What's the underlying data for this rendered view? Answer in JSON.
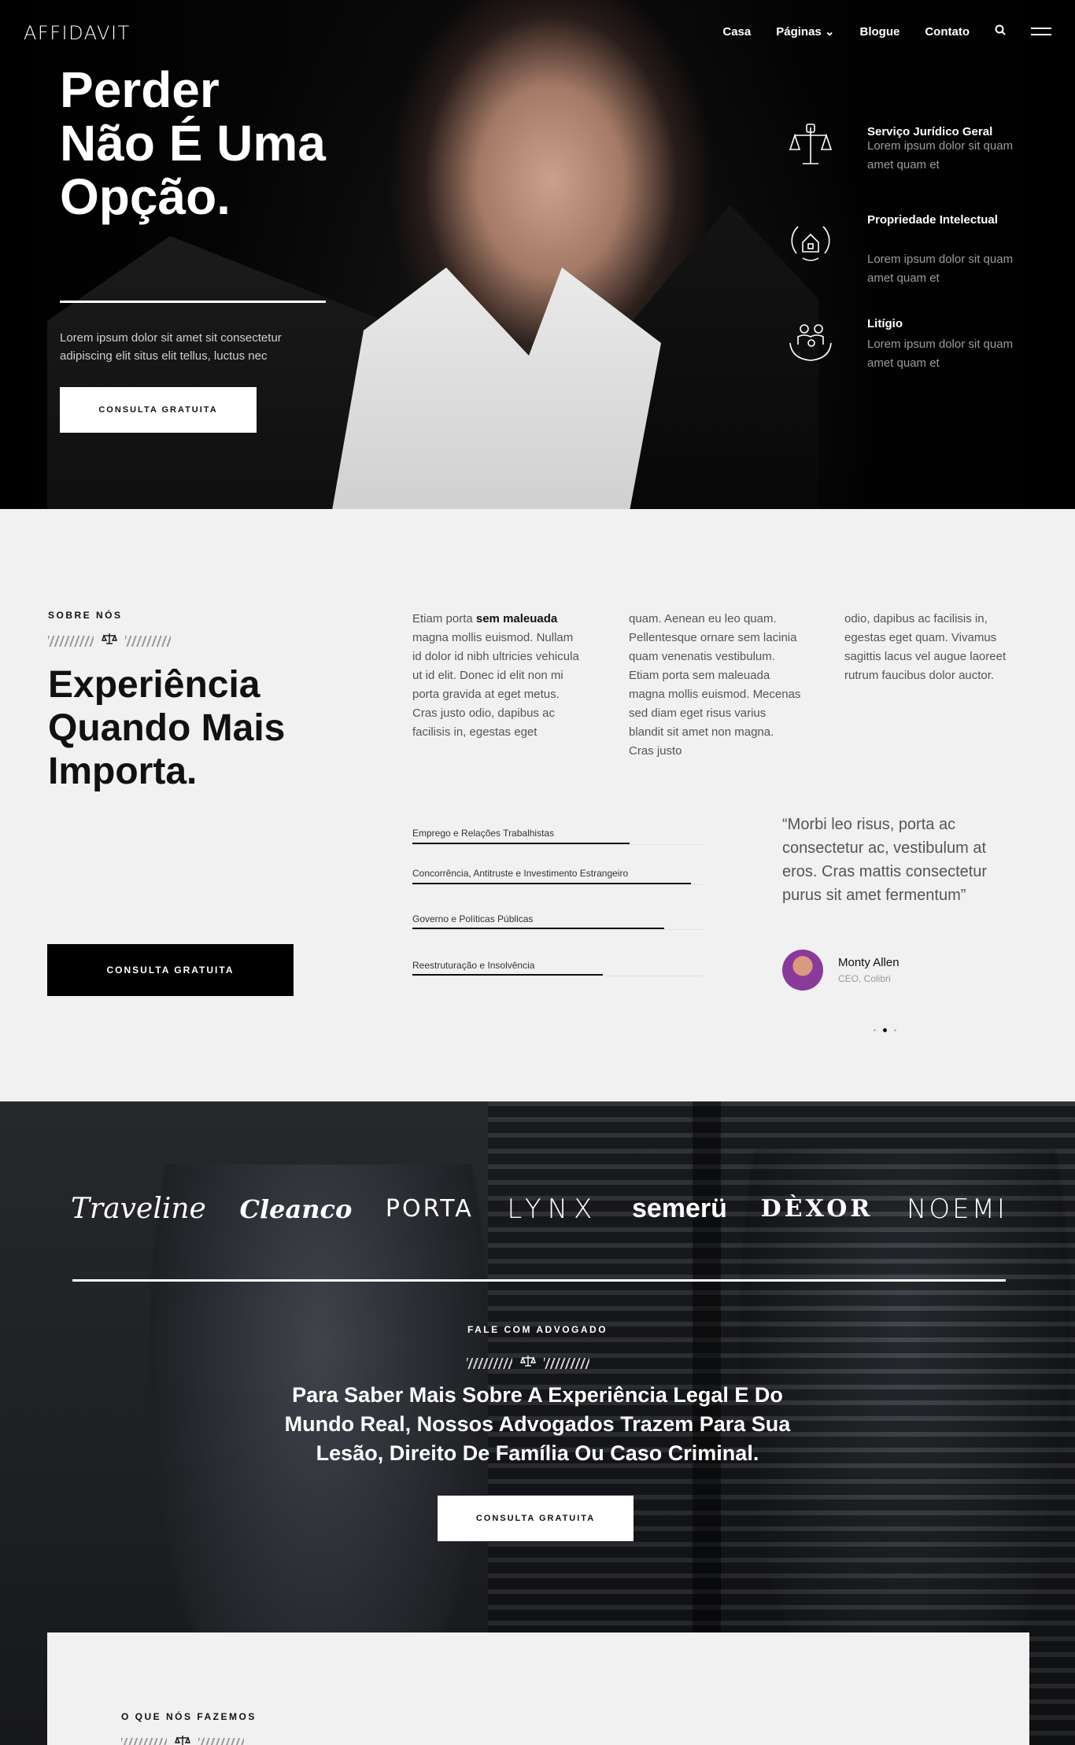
{
  "header": {
    "logo": "AFFIDAVIT",
    "nav": [
      "Casa",
      "Páginas ⌄",
      "Blogue",
      "Contato"
    ]
  },
  "hero": {
    "title": "Perder Não É Uma Opção.",
    "text": "Lorem ipsum dolor sit amet sit consectetur adipiscing elit situs elit tellus, luctus nec",
    "cta": "CONSULTA GRATUITA",
    "services": [
      {
        "title": "Serviço Jurídico Geral",
        "desc": "Lorem ipsum dolor sit quam amet quam et",
        "icon": "scales-fist-icon"
      },
      {
        "title": "Propriedade Intelectual",
        "desc": "Lorem ipsum dolor sit quam amet quam et",
        "icon": "laurel-house-icon"
      },
      {
        "title": "Litígio",
        "desc": "Lorem ipsum dolor sit quam amet quam et",
        "icon": "family-hands-icon"
      }
    ]
  },
  "about": {
    "eyebrow": "SOBRE NÓS",
    "title": "Experiência Quando Mais Importa.",
    "col1_lead": "Etiam porta ",
    "col1_bold": "sem maleuada",
    "col1_rest": " magna mollis euismod. Nullam id dolor id nibh ultricies vehicula ut id elit. Donec id elit non mi porta gravida at eget metus. Cras justo odio, dapibus ac facilisis in, egestas eget",
    "col2": "quam. Aenean eu leo quam. Pellentesque ornare sem lacinia quam venenatis vestibulum. Etiam porta sem maleuada magna mollis euismod. Mecenas sed diam eget risus varius blandit sit amet non magna. Cras justo",
    "col3": "odio, dapibus ac facilisis in, egestas eget quam. Vivamus sagittis lacus vel augue laoreet rutrum faucibus dolor auctor.",
    "links": [
      "Emprego e Relações Trabalhistas",
      "Concorrência, Antitruste e Investimento Estrangeiro",
      "Governo e Políticas Públicas",
      "Reestruturação e Insolvência"
    ],
    "quote": "“Morbi leo risus, porta ac consectetur ac, vestibulum at eros. Cras mattis consectetur purus sit amet fermentum”",
    "quote_name": "Monty Allen",
    "quote_role": "CEO, Colibri",
    "cta": "CONSULTA GRATUITA"
  },
  "brands": [
    "Traveline",
    "Cleanco",
    "PORTA",
    "LYNX",
    "semerü",
    "DÈXOR",
    "NOEMI"
  ],
  "contact": {
    "eyebrow": "FALE COM ADVOGADO",
    "title": "Para Saber Mais Sobre A Experiência Legal E Do Mundo Real, Nossos Advogados Trazem Para Sua Lesão, Direito De Família Ou Caso Criminal.",
    "cta": "CONSULTA GRATUITA"
  },
  "services_section": {
    "eyebrow": "O QUE NÓS FAZEMOS"
  },
  "colors": {
    "dark": "#050505",
    "light": "#f1f1f1",
    "accent": "#ffffff"
  }
}
